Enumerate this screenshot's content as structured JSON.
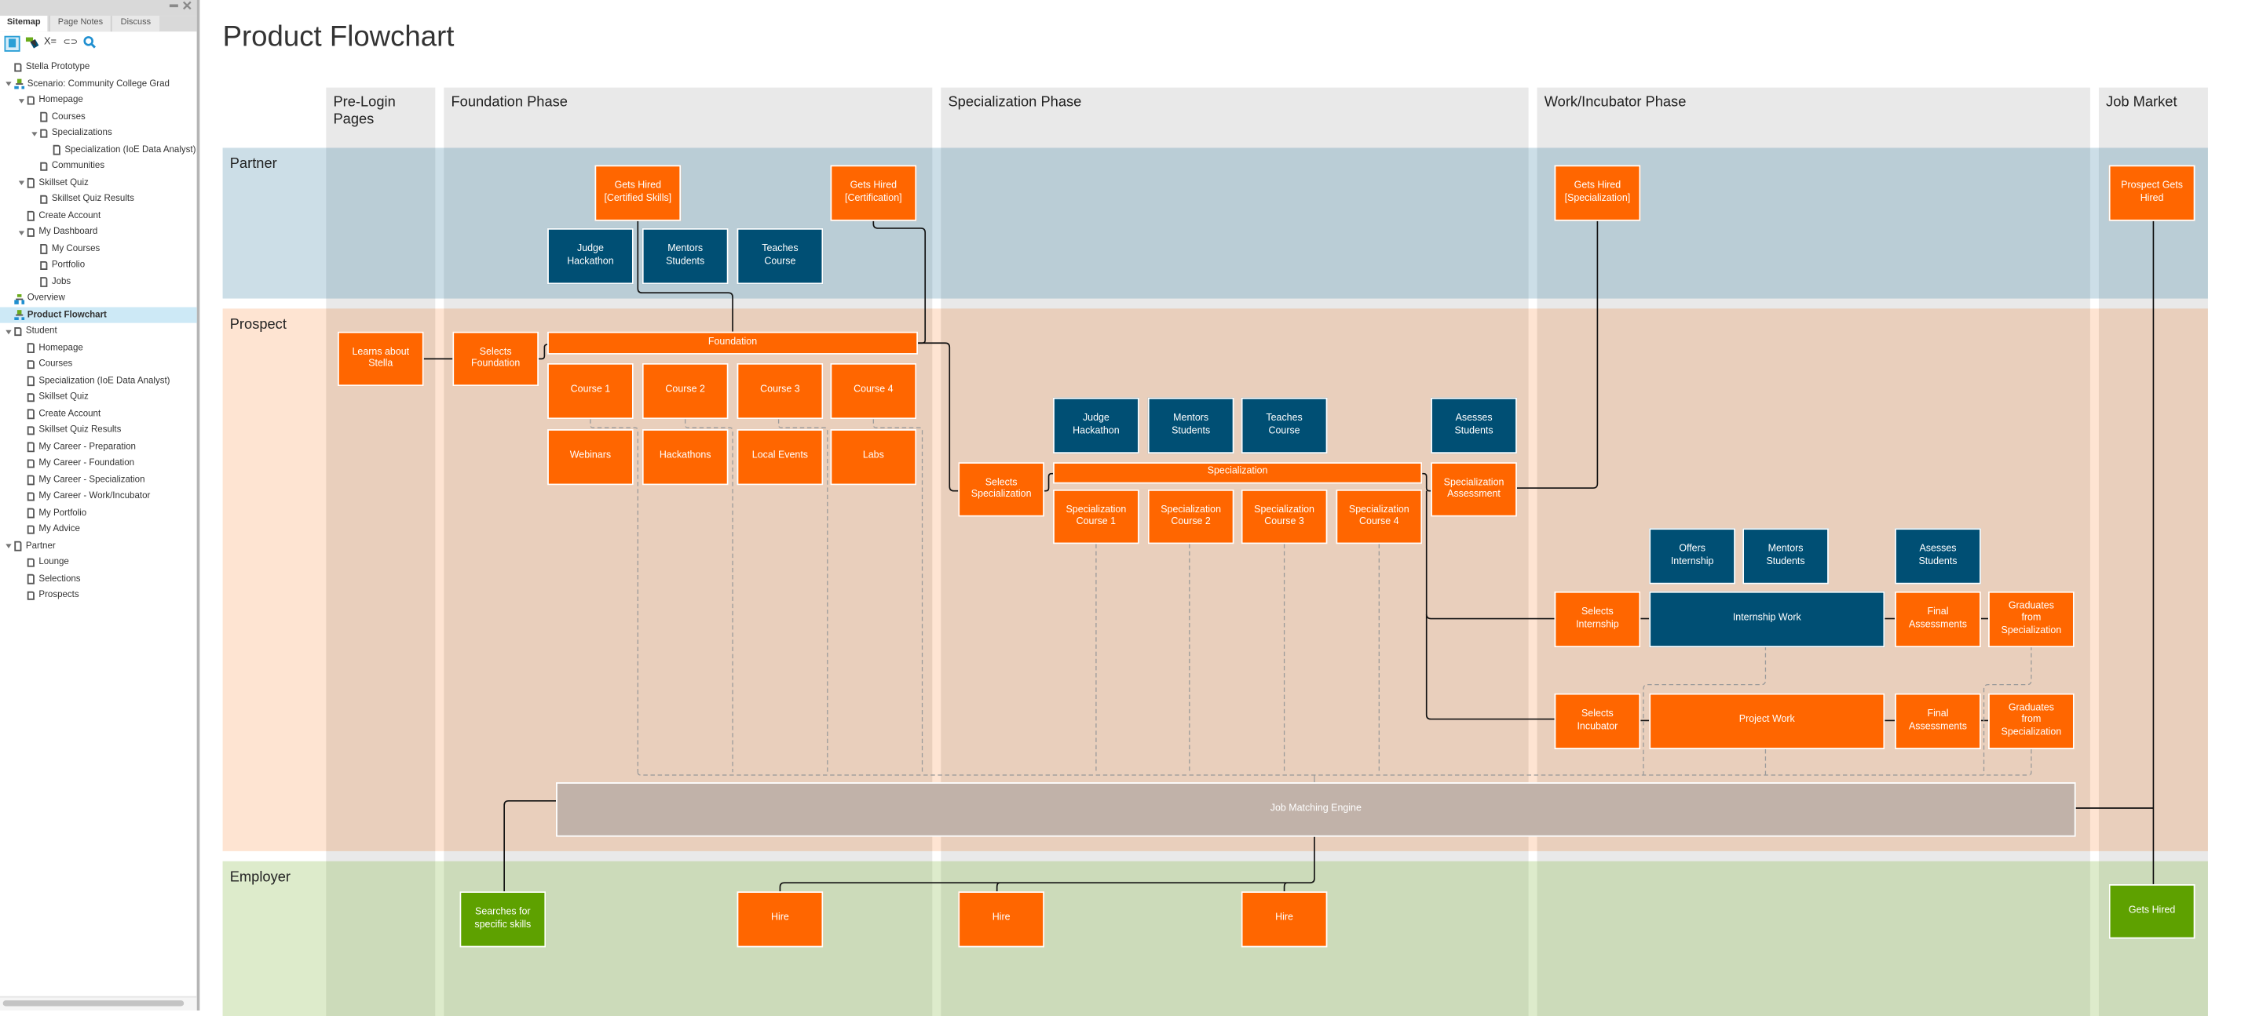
{
  "sidebar": {
    "tabs": [
      "Sitemap",
      "Page Notes",
      "Discuss"
    ],
    "active_tab": "Sitemap",
    "tools": [
      "sitemap-icon",
      "flow-icon",
      "variables-icon",
      "link-icon",
      "search-icon"
    ],
    "tools_text": {
      "variables": "X=",
      "link": "⊂⊃",
      "search": "🔍"
    },
    "tree": [
      {
        "label": "Stella Prototype",
        "level": 0,
        "icon": "page",
        "expanded": null
      },
      {
        "label": "Scenario: Community College Grad",
        "level": 0,
        "icon": "flow",
        "expanded": true
      },
      {
        "label": "Homepage",
        "level": 1,
        "icon": "page",
        "expanded": true
      },
      {
        "label": "Courses",
        "level": 2,
        "icon": "page",
        "expanded": null
      },
      {
        "label": "Specializations",
        "level": 2,
        "icon": "page",
        "expanded": true
      },
      {
        "label": "Specialization (IoE Data Analyst)",
        "level": 3,
        "icon": "page",
        "expanded": null
      },
      {
        "label": "Communities",
        "level": 2,
        "icon": "page",
        "expanded": null
      },
      {
        "label": "Skillset Quiz",
        "level": 1,
        "icon": "page",
        "expanded": true
      },
      {
        "label": "Skillset Quiz Results",
        "level": 2,
        "icon": "page",
        "expanded": null
      },
      {
        "label": "Create Account",
        "level": 1,
        "icon": "page",
        "expanded": null
      },
      {
        "label": "My Dashboard",
        "level": 1,
        "icon": "page",
        "expanded": true
      },
      {
        "label": "My Courses",
        "level": 2,
        "icon": "page",
        "expanded": null
      },
      {
        "label": "Portfolio",
        "level": 2,
        "icon": "page",
        "expanded": null
      },
      {
        "label": "Jobs",
        "level": 2,
        "icon": "page",
        "expanded": null
      },
      {
        "label": "Overview",
        "level": 0,
        "icon": "flow",
        "expanded": null
      },
      {
        "label": "Product Flowchart",
        "level": 0,
        "icon": "flow",
        "expanded": null,
        "selected": true
      },
      {
        "label": "Student",
        "level": 0,
        "icon": "page",
        "expanded": true
      },
      {
        "label": "Homepage",
        "level": 1,
        "icon": "page",
        "expanded": null
      },
      {
        "label": "Courses",
        "level": 1,
        "icon": "page",
        "expanded": null
      },
      {
        "label": "Specialization (IoE Data Analyst)",
        "level": 1,
        "icon": "page",
        "expanded": null
      },
      {
        "label": "Skillset Quiz",
        "level": 1,
        "icon": "page",
        "expanded": null
      },
      {
        "label": "Create Account",
        "level": 1,
        "icon": "page",
        "expanded": null
      },
      {
        "label": "Skillset Quiz Results",
        "level": 1,
        "icon": "page",
        "expanded": null
      },
      {
        "label": "My Career - Preparation",
        "level": 1,
        "icon": "page",
        "expanded": null
      },
      {
        "label": "My Career - Foundation",
        "level": 1,
        "icon": "page",
        "expanded": null
      },
      {
        "label": "My Career - Specialization",
        "level": 1,
        "icon": "page",
        "expanded": null
      },
      {
        "label": "My Career - Work/Incubator",
        "level": 1,
        "icon": "page",
        "expanded": null
      },
      {
        "label": "My Portfolio",
        "level": 1,
        "icon": "page",
        "expanded": null
      },
      {
        "label": "My Advice",
        "level": 1,
        "icon": "page",
        "expanded": null
      },
      {
        "label": "Partner",
        "level": 0,
        "icon": "page",
        "expanded": true
      },
      {
        "label": "Lounge",
        "level": 1,
        "icon": "page",
        "expanded": null
      },
      {
        "label": "Selections",
        "level": 1,
        "icon": "page",
        "expanded": null
      },
      {
        "label": "Prospects",
        "level": 1,
        "icon": "page",
        "expanded": null
      }
    ]
  },
  "page": {
    "title": "Product Flowchart"
  },
  "colors": {
    "action": "#ff6600",
    "partner_action": "#004f74",
    "employer_action": "#5ea100",
    "system": "#c1b2a9",
    "lane_partner": "#c9dbe3",
    "lane_prospect": "#fde0cc",
    "lane_employer": "#dde9cc",
    "column_header": "#e9e9e9"
  },
  "columns": [
    {
      "id": "prelogin",
      "label": "Pre-Login\nPages"
    },
    {
      "id": "foundation",
      "label": "Foundation Phase"
    },
    {
      "id": "specialization",
      "label": "Specialization Phase"
    },
    {
      "id": "work",
      "label": "Work/Incubator Phase"
    },
    {
      "id": "market",
      "label": "Job Market"
    }
  ],
  "lanes": [
    {
      "id": "partner",
      "label": "Partner"
    },
    {
      "id": "prospect",
      "label": "Prospect"
    },
    {
      "id": "employer",
      "label": "Employer"
    }
  ],
  "nodes": {
    "gets_hired_cert_skills": {
      "label": "Gets Hired\n[Certified Skills]",
      "kind": "action"
    },
    "gets_hired_cert": {
      "label": "Gets Hired\n[Certification]",
      "kind": "action"
    },
    "gets_hired_spec": {
      "label": "Gets Hired\n[Specialization]",
      "kind": "action"
    },
    "prospect_gets_hired": {
      "label": "Prospect Gets\nHired",
      "kind": "action"
    },
    "p_judge_hackathon": {
      "label": "Judge\nHackathon",
      "kind": "partner"
    },
    "p_mentors": {
      "label": "Mentors\nStudents",
      "kind": "partner"
    },
    "p_teaches": {
      "label": "Teaches\nCourse",
      "kind": "partner"
    },
    "learns_about": {
      "label": "Learns about\nStella",
      "kind": "action"
    },
    "selects_foundation": {
      "label": "Selects\nFoundation",
      "kind": "action"
    },
    "foundation": {
      "label": "Foundation",
      "kind": "action"
    },
    "course1": {
      "label": "Course 1",
      "kind": "action"
    },
    "course2": {
      "label": "Course 2",
      "kind": "action"
    },
    "course3": {
      "label": "Course 3",
      "kind": "action"
    },
    "course4": {
      "label": "Course 4",
      "kind": "action"
    },
    "webinars": {
      "label": "Webinars",
      "kind": "action"
    },
    "hackathons": {
      "label": "Hackathons",
      "kind": "action"
    },
    "local_events": {
      "label": "Local Events",
      "kind": "action"
    },
    "labs": {
      "label": "Labs",
      "kind": "action"
    },
    "s_judge_hackathon": {
      "label": "Judge\nHackathon",
      "kind": "partner"
    },
    "s_mentors": {
      "label": "Mentors\nStudents",
      "kind": "partner"
    },
    "s_teaches": {
      "label": "Teaches\nCourse",
      "kind": "partner"
    },
    "s_assesses": {
      "label": "Asesses\nStudents",
      "kind": "partner"
    },
    "selects_specialization": {
      "label": "Selects\nSpecialization",
      "kind": "action"
    },
    "specialization": {
      "label": "Specialization",
      "kind": "action"
    },
    "spec_course1": {
      "label": "Specialization\nCourse 1",
      "kind": "action"
    },
    "spec_course2": {
      "label": "Specialization\nCourse 2",
      "kind": "action"
    },
    "spec_course3": {
      "label": "Specialization\nCourse 3",
      "kind": "action"
    },
    "spec_course4": {
      "label": "Specialization\nCourse 4",
      "kind": "action"
    },
    "spec_assessment": {
      "label": "Specialization\nAssessment",
      "kind": "action"
    },
    "offers_internship": {
      "label": "Offers\nInternship",
      "kind": "partner"
    },
    "w_mentors": {
      "label": "Mentors\nStudents",
      "kind": "partner"
    },
    "w_assesses": {
      "label": "Asesses\nStudents",
      "kind": "partner"
    },
    "selects_internship": {
      "label": "Selects\nInternship",
      "kind": "action"
    },
    "internship_work": {
      "label": "Internship Work",
      "kind": "partner"
    },
    "final_assess_1": {
      "label": "Final\nAssessments",
      "kind": "action"
    },
    "graduates_1": {
      "label": "Graduates\nfrom\nSpecialization",
      "kind": "action"
    },
    "selects_incubator": {
      "label": "Selects\nIncubator",
      "kind": "action"
    },
    "project_work": {
      "label": "Project Work",
      "kind": "action"
    },
    "final_assess_2": {
      "label": "Final\nAssessments",
      "kind": "action"
    },
    "graduates_2": {
      "label": "Graduates\nfrom\nSpecialization",
      "kind": "action"
    },
    "job_matching": {
      "label": "Job Matching Engine",
      "kind": "system"
    },
    "searches_skills": {
      "label": "Searches for\nspecific skills",
      "kind": "employer"
    },
    "hire1": {
      "label": "Hire",
      "kind": "action"
    },
    "hire2": {
      "label": "Hire",
      "kind": "action"
    },
    "hire3": {
      "label": "Hire",
      "kind": "action"
    },
    "employer_gets_hired": {
      "label": "Gets Hired",
      "kind": "employer"
    }
  }
}
